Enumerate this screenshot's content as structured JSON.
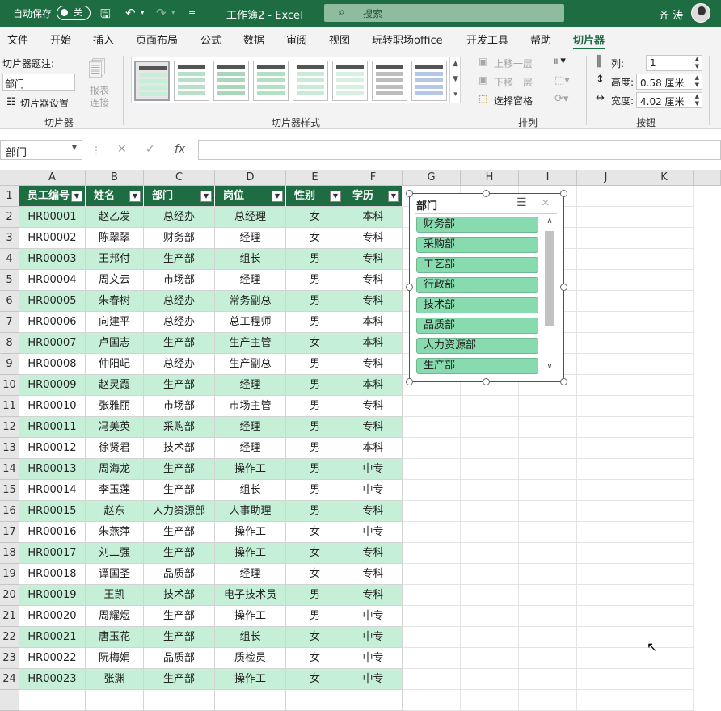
{
  "titlebar": {
    "autosave_label": "自动保存",
    "autosave_state": "关",
    "title": "工作簿2 - Excel",
    "search_placeholder": "搜索",
    "user_name": "齐 涛"
  },
  "ribbon_tabs": [
    "文件",
    "开始",
    "插入",
    "页面布局",
    "公式",
    "数据",
    "审阅",
    "视图",
    "玩转职场office",
    "开发工具",
    "帮助",
    "切片器"
  ],
  "active_tab": "切片器",
  "ribbon": {
    "slicer_group": {
      "caption_label": "切片器题注:",
      "caption_value": "部门",
      "settings_label": "切片器设置",
      "report_connections_1": "报表",
      "report_connections_2": "连接",
      "group_label": "切片器"
    },
    "styles_group": {
      "group_label": "切片器样式"
    },
    "arrange_group": {
      "bring_forward": "上移一层",
      "send_backward": "下移一层",
      "selection_pane": "选择窗格",
      "group_label": "排列"
    },
    "buttons_group": {
      "columns_label": "列:",
      "columns_value": "1",
      "height_label": "高度:",
      "height_value": "0.58 厘米",
      "width_label": "宽度:",
      "width_value": "4.02 厘米",
      "group_label": "按钮"
    }
  },
  "formula_bar": {
    "name_box": "部门",
    "fx": "fx",
    "content": ""
  },
  "columns": [
    "A",
    "B",
    "C",
    "D",
    "E",
    "F",
    "G",
    "H",
    "I",
    "J",
    "K"
  ],
  "table": {
    "headers": [
      "员工编号",
      "姓名",
      "部门",
      "岗位",
      "性别",
      "学历"
    ],
    "rows": [
      [
        "HR00001",
        "赵乙发",
        "总经办",
        "总经理",
        "女",
        "本科"
      ],
      [
        "HR00002",
        "陈翠翠",
        "财务部",
        "经理",
        "女",
        "专科"
      ],
      [
        "HR00003",
        "王邦付",
        "生产部",
        "组长",
        "男",
        "专科"
      ],
      [
        "HR00004",
        "周文云",
        "市场部",
        "经理",
        "男",
        "专科"
      ],
      [
        "HR00005",
        "朱春树",
        "总经办",
        "常务副总",
        "男",
        "专科"
      ],
      [
        "HR00006",
        "向建平",
        "总经办",
        "总工程师",
        "男",
        "本科"
      ],
      [
        "HR00007",
        "卢国志",
        "生产部",
        "生产主管",
        "女",
        "本科"
      ],
      [
        "HR00008",
        "仲阳屺",
        "总经办",
        "生产副总",
        "男",
        "专科"
      ],
      [
        "HR00009",
        "赵灵霞",
        "生产部",
        "经理",
        "男",
        "本科"
      ],
      [
        "HR00010",
        "张雅丽",
        "市场部",
        "市场主管",
        "男",
        "专科"
      ],
      [
        "HR00011",
        "冯美英",
        "采购部",
        "经理",
        "男",
        "专科"
      ],
      [
        "HR00012",
        "徐贤君",
        "技术部",
        "经理",
        "男",
        "本科"
      ],
      [
        "HR00013",
        "周海龙",
        "生产部",
        "操作工",
        "男",
        "中专"
      ],
      [
        "HR00014",
        "李玉莲",
        "生产部",
        "组长",
        "男",
        "中专"
      ],
      [
        "HR00015",
        "赵东",
        "人力资源部",
        "人事助理",
        "男",
        "专科"
      ],
      [
        "HR00016",
        "朱燕萍",
        "生产部",
        "操作工",
        "女",
        "中专"
      ],
      [
        "HR00017",
        "刘二强",
        "生产部",
        "操作工",
        "女",
        "专科"
      ],
      [
        "HR00018",
        "谭国圣",
        "品质部",
        "经理",
        "女",
        "专科"
      ],
      [
        "HR00019",
        "王凯",
        "技术部",
        "电子技术员",
        "男",
        "专科"
      ],
      [
        "HR00020",
        "周耀煜",
        "生产部",
        "操作工",
        "男",
        "中专"
      ],
      [
        "HR00021",
        "唐玉花",
        "生产部",
        "组长",
        "女",
        "中专"
      ],
      [
        "HR00022",
        "阮梅娟",
        "品质部",
        "质检员",
        "女",
        "中专"
      ],
      [
        "HR00023",
        "张渊",
        "生产部",
        "操作工",
        "女",
        "中专"
      ]
    ]
  },
  "slicer": {
    "title": "部门",
    "items": [
      "财务部",
      "采购部",
      "工艺部",
      "行政部",
      "技术部",
      "品质部",
      "人力资源部",
      "生产部"
    ]
  },
  "colors": {
    "accent": "#1e6c41",
    "band": "#c6efd8",
    "slicer_item": "#88dbae"
  }
}
